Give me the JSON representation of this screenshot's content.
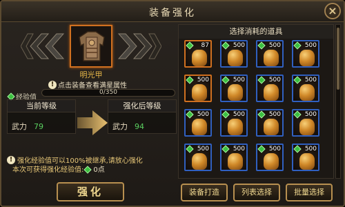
{
  "window": {
    "title": "装备强化",
    "close_label": "×"
  },
  "equipment": {
    "name": "明光甲",
    "hint": "点击装备查看满星属性",
    "icon": "armor-icon"
  },
  "exp": {
    "label": "经验值",
    "current": 0,
    "max": 350,
    "text": "0/350"
  },
  "current_level": {
    "header": "当前等级",
    "stat_name": "武力",
    "stat_value": "79"
  },
  "after_level": {
    "header": "强化后等级",
    "stat_name": "武力",
    "stat_value": "94"
  },
  "notices": {
    "inherit": "强化经验值可以100%被继承,请放心强化",
    "gain_label": "本次可获得强化经验值:",
    "gain_value": "0点"
  },
  "buttons": {
    "strengthen": "强化",
    "forge": "装备打造",
    "list_select": "列表选择",
    "batch_select": "批量选择"
  },
  "consumables": {
    "header": "选择消耗的道具",
    "items": [
      {
        "count": "87",
        "border": "orange"
      },
      {
        "count": "500",
        "border": "blue"
      },
      {
        "count": "500",
        "border": "blue"
      },
      {
        "count": "500",
        "border": "blue"
      },
      {
        "count": "500",
        "border": "orange"
      },
      {
        "count": "500",
        "border": "blue"
      },
      {
        "count": "500",
        "border": "blue"
      },
      {
        "count": "500",
        "border": "blue"
      },
      {
        "count": "500",
        "border": "blue"
      },
      {
        "count": "500",
        "border": "blue"
      },
      {
        "count": "500",
        "border": "blue"
      },
      {
        "count": "500",
        "border": "blue"
      },
      {
        "count": "500",
        "border": "blue"
      },
      {
        "count": "500",
        "border": "blue"
      },
      {
        "count": "500",
        "border": "blue"
      },
      {
        "count": "500",
        "border": "blue"
      }
    ]
  },
  "colors": {
    "accent_gold": "#e8b848",
    "stat_green": "#5ad060",
    "orange_border": "#d07020",
    "blue_border": "#3060c0"
  }
}
